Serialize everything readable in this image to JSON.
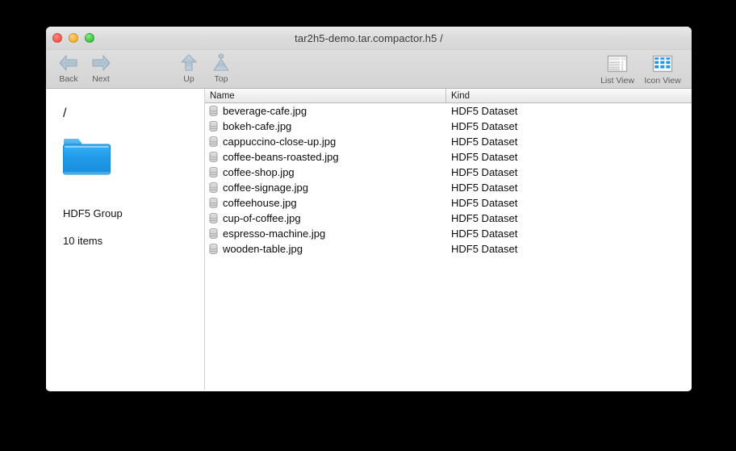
{
  "window": {
    "title": "tar2h5-demo.tar.compactor.h5 /",
    "traffic": {
      "close_label": "close",
      "minimize_label": "minimize",
      "zoom_label": "zoom"
    }
  },
  "toolbar": {
    "back_label": "Back",
    "next_label": "Next",
    "up_label": "Up",
    "top_label": "Top",
    "list_view_label": "List View",
    "icon_view_label": "Icon View"
  },
  "sidebar": {
    "path": "/",
    "kind": "HDF5 Group",
    "item_count": "10 items",
    "folder_icon": "folder-icon"
  },
  "list": {
    "columns": [
      "Name",
      "Kind"
    ],
    "rows": [
      {
        "name": "beverage-cafe.jpg",
        "kind": "HDF5 Dataset"
      },
      {
        "name": "bokeh-cafe.jpg",
        "kind": "HDF5 Dataset"
      },
      {
        "name": "cappuccino-close-up.jpg",
        "kind": "HDF5 Dataset"
      },
      {
        "name": "coffee-beans-roasted.jpg",
        "kind": "HDF5 Dataset"
      },
      {
        "name": "coffee-shop.jpg",
        "kind": "HDF5 Dataset"
      },
      {
        "name": "coffee-signage.jpg",
        "kind": "HDF5 Dataset"
      },
      {
        "name": "coffeehouse.jpg",
        "kind": "HDF5 Dataset"
      },
      {
        "name": "cup-of-coffee.jpg",
        "kind": "HDF5 Dataset"
      },
      {
        "name": "espresso-machine.jpg",
        "kind": "HDF5 Dataset"
      },
      {
        "name": "wooden-table.jpg",
        "kind": "HDF5 Dataset"
      }
    ]
  },
  "colors": {
    "folder_blue": "#1e9ae8",
    "icon_view_blue": "#2196e8",
    "window_chrome": "#d8d8d8",
    "desktop": "#000000"
  }
}
